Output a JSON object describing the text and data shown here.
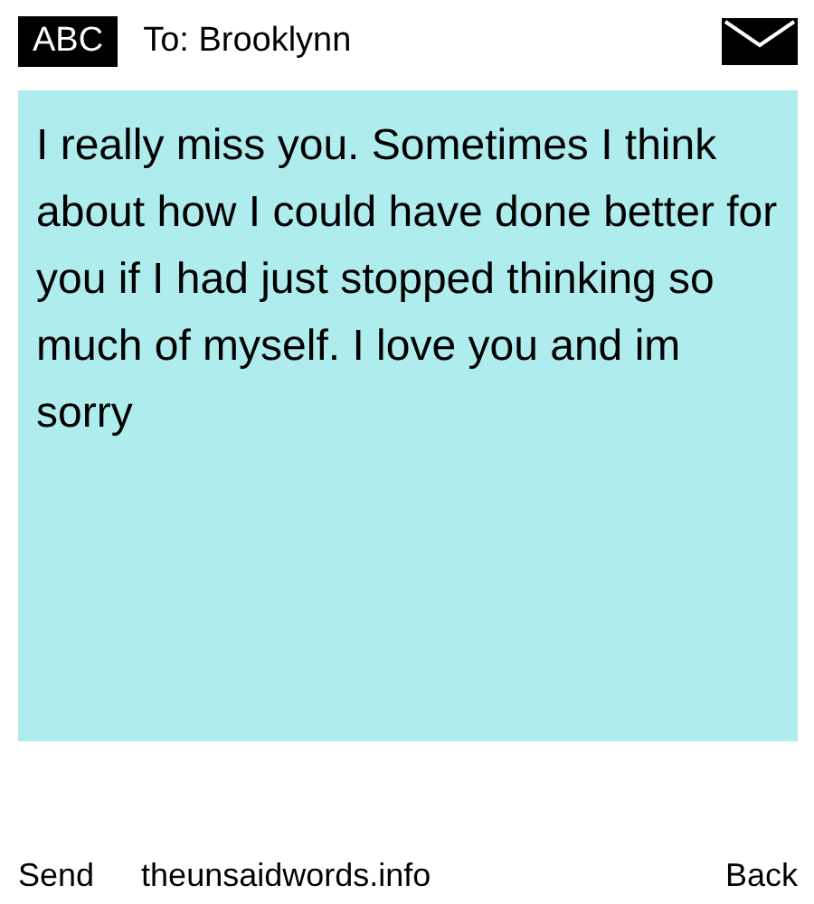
{
  "header": {
    "mode": "ABC",
    "recipient": "To: Brooklynn"
  },
  "message": {
    "text": "I really miss you. Sometimes I think about how I could have done better for you if I had just stopped thinking so much of myself. I love you and im sorry"
  },
  "footer": {
    "send": "Send",
    "site": "theunsaidwords.info",
    "back": "Back"
  }
}
